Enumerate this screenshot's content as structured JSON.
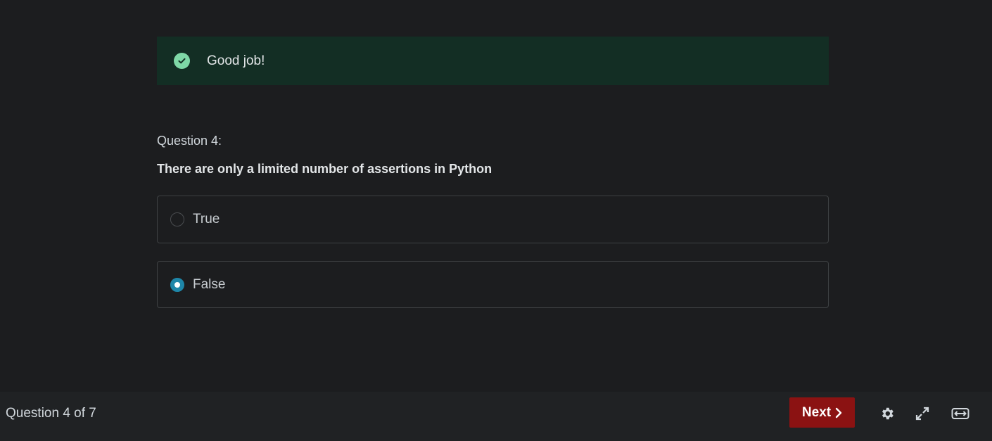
{
  "alert": {
    "text": "Good job!",
    "icon": "check-circle-icon",
    "color": "#132e24"
  },
  "question": {
    "number_label": "Question 4:",
    "text": "There are only a limited number of assertions in Python",
    "options": [
      {
        "label": "True",
        "selected": false
      },
      {
        "label": "False",
        "selected": true
      }
    ]
  },
  "footer": {
    "progress": "Question 4 of 7",
    "next_label": "Next",
    "next_color": "#8b1212",
    "icons": [
      "gear-icon",
      "expand-icon",
      "widen-icon"
    ]
  }
}
